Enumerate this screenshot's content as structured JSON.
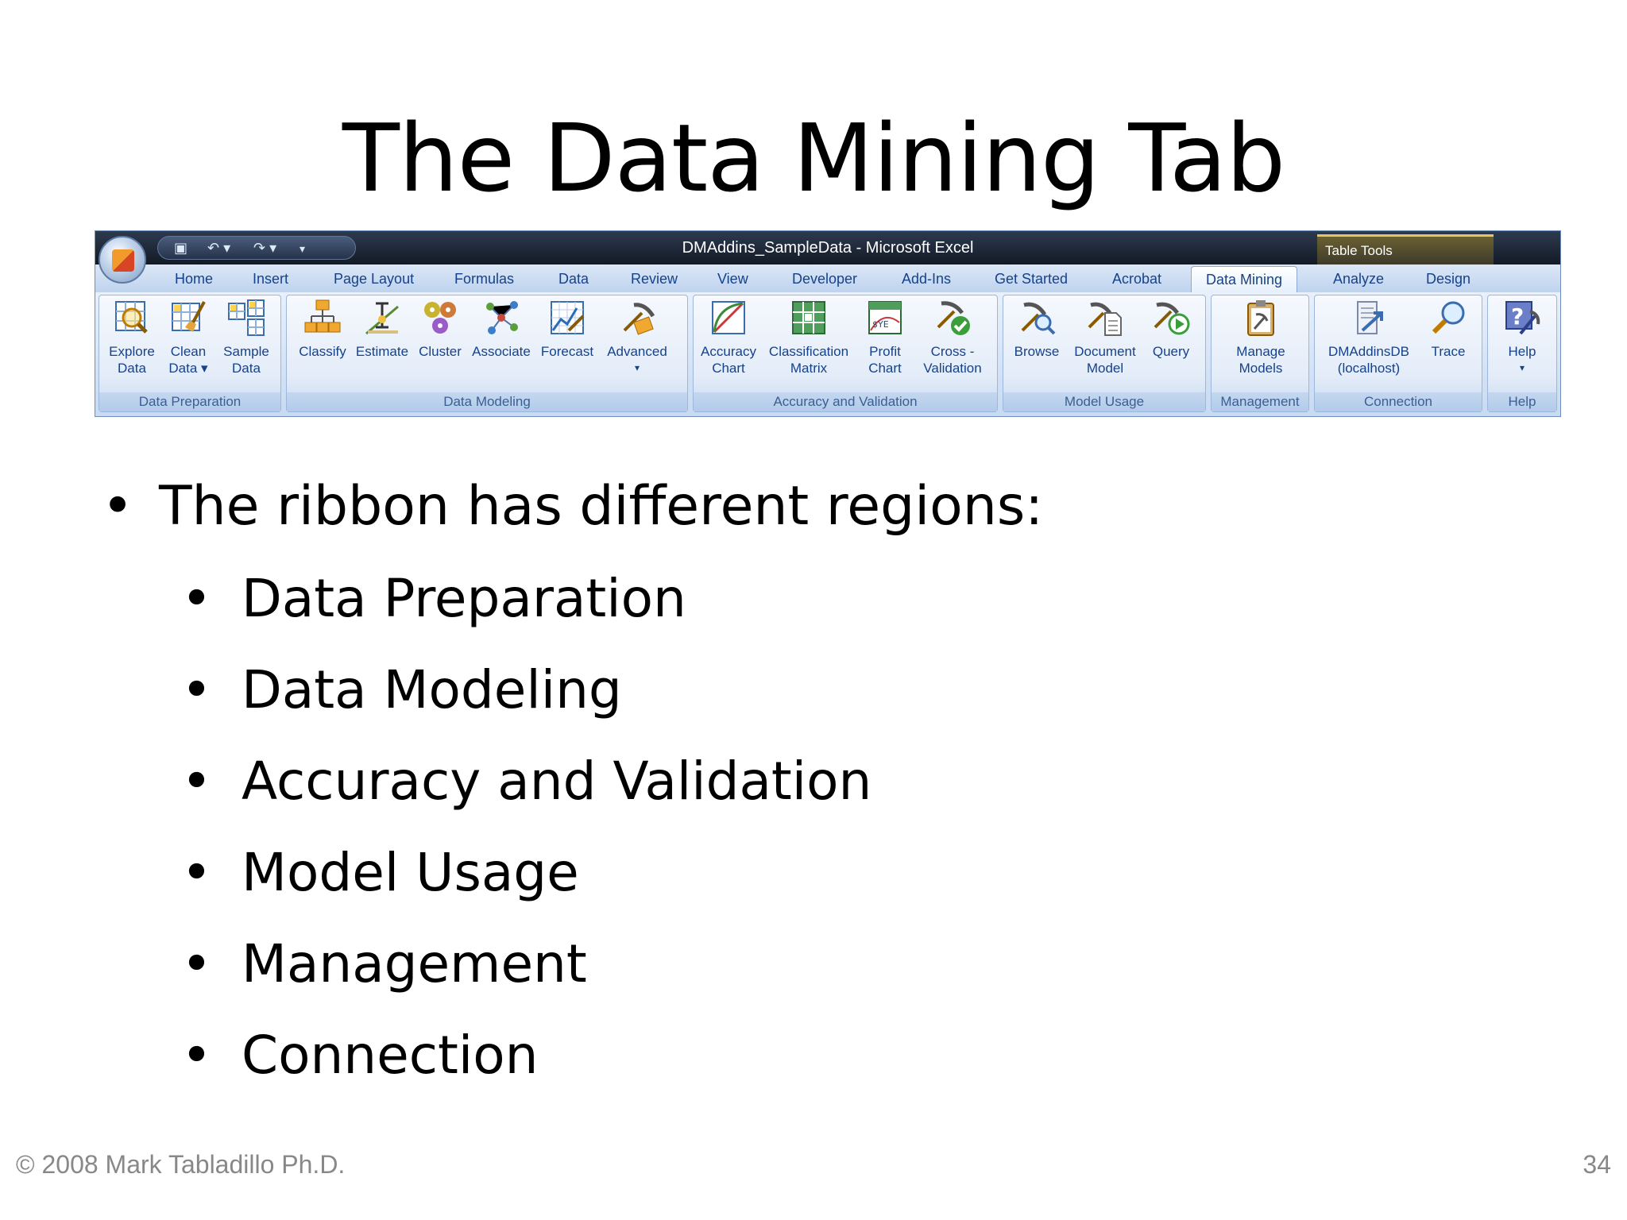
{
  "slide": {
    "title": "The Data Mining Tab",
    "page_number": "34",
    "copyright": "© 2008 Mark Tabladillo Ph.D."
  },
  "window": {
    "title": "DMAddins_SampleData - Microsoft Excel",
    "context_tab": "Table Tools"
  },
  "tabs": [
    "Home",
    "Insert",
    "Page Layout",
    "Formulas",
    "Data",
    "Review",
    "View",
    "Developer",
    "Add-Ins",
    "Get Started",
    "Acrobat",
    "Data Mining",
    "Analyze",
    "Design"
  ],
  "active_tab": "Data Mining",
  "groups": [
    {
      "label": "Data Preparation",
      "buttons": [
        [
          "Explore",
          "Data"
        ],
        [
          "Clean",
          "Data ▾"
        ],
        [
          "Sample",
          "Data"
        ]
      ]
    },
    {
      "label": "Data Modeling",
      "buttons": [
        [
          "Classify",
          ""
        ],
        [
          "Estimate",
          ""
        ],
        [
          "Cluster",
          ""
        ],
        [
          "Associate",
          ""
        ],
        [
          "Forecast",
          ""
        ],
        [
          "Advanced",
          "▾"
        ]
      ]
    },
    {
      "label": "Accuracy and Validation",
      "buttons": [
        [
          "Accuracy",
          "Chart"
        ],
        [
          "Classification",
          "Matrix"
        ],
        [
          "Profit",
          "Chart"
        ],
        [
          "Cross -",
          "Validation"
        ]
      ]
    },
    {
      "label": "Model Usage",
      "buttons": [
        [
          "Browse",
          ""
        ],
        [
          "Document",
          "Model"
        ],
        [
          "Query",
          ""
        ]
      ]
    },
    {
      "label": "Management",
      "buttons": [
        [
          "Manage",
          "Models"
        ]
      ]
    },
    {
      "label": "Connection",
      "buttons": [
        [
          "DMAddinsDB",
          "(localhost)"
        ],
        [
          "Trace",
          ""
        ]
      ]
    },
    {
      "label": "Help",
      "buttons": [
        [
          "Help",
          "▾"
        ]
      ]
    }
  ],
  "bullets": {
    "main": "The ribbon has different regions:",
    "sub": [
      "Data Preparation",
      "Data Modeling",
      "Accuracy and Validation",
      "Model Usage",
      "Management",
      "Connection"
    ]
  },
  "colors": {
    "ribbon_text": "#15428b",
    "titlebar": "#1d2637",
    "accent": "#e5c75d"
  }
}
